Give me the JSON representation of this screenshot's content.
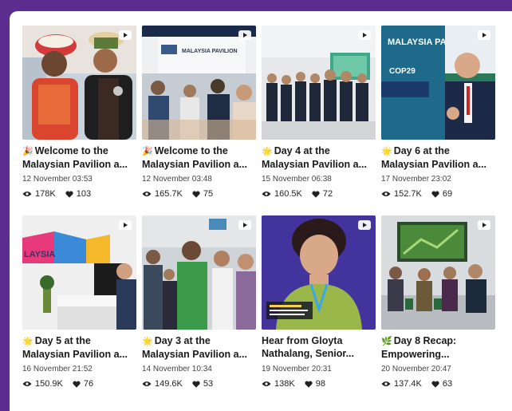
{
  "posts": [
    {
      "emoji": "🎉",
      "title": "Welcome to the Malaysian Pavilion a...",
      "date": "12 November 03:53",
      "views": "178K",
      "likes": "103",
      "thumb_icon": "people-costume-photo"
    },
    {
      "emoji": "🎉",
      "title": "Welcome to the Malaysian Pavilion a...",
      "date": "12 November 03:48",
      "views": "165.7K",
      "likes": "75",
      "thumb_icon": "pavilion-crowd-photo"
    },
    {
      "emoji": "🌟",
      "title": "Day 4 at the Malaysian Pavilion a...",
      "date": "15 November 06:38",
      "views": "160.5K",
      "likes": "72",
      "thumb_icon": "group-photo"
    },
    {
      "emoji": "🌟",
      "title": "Day 6 at the Malaysian Pavilion a...",
      "date": "17 November 23:02",
      "views": "152.7K",
      "likes": "69",
      "thumb_icon": "speaker-photo"
    },
    {
      "emoji": "🌟",
      "title": "Day 5 at the Malaysian Pavilion a...",
      "date": "16 November 21:52",
      "views": "150.9K",
      "likes": "76",
      "thumb_icon": "booth-photo"
    },
    {
      "emoji": "🌟",
      "title": "Day 3 at the Malaysian Pavilion a...",
      "date": "14 November 10:34",
      "views": "149.6K",
      "likes": "53",
      "thumb_icon": "crowd-photo"
    },
    {
      "emoji": "",
      "title": "Hear from Gloyta Nathalang, Senior...",
      "date": "19 November 20:31",
      "views": "138K",
      "likes": "98",
      "thumb_icon": "interview-photo"
    },
    {
      "emoji": "🌿",
      "title": "Day 8 Recap: Empowering...",
      "date": "20 November 20:47",
      "views": "137.4K",
      "likes": "63",
      "thumb_icon": "panel-photo"
    }
  ],
  "thumb_texts": {
    "malaysia_pavilion": "MALAYSIA PAVILION",
    "cop29": "COP29",
    "lysia": "LAYSIA"
  }
}
